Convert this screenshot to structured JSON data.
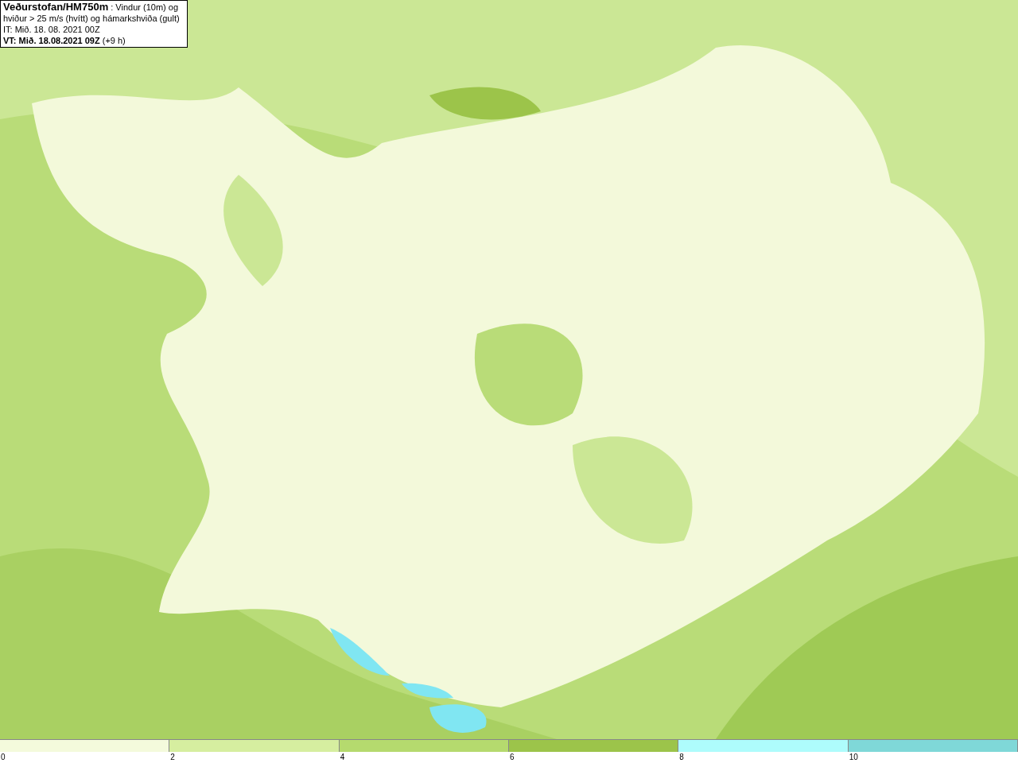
{
  "header": {
    "title_line": "**Veðurstofan/HM750m** : Vindur (10m) og hviður > 25 m/s (hvítt) og hámarkshviða (gult)",
    "initial_time": "IT: Mið. 18. 08. 2021 00Z",
    "valid_time": "**VT: Mið. 18.08.2021 09Z** (+9 h)"
  },
  "legend": {
    "bins": [
      {
        "color": "#f4fadc",
        "label": "0"
      },
      {
        "color": "#d6eea0",
        "label": "2"
      },
      {
        "color": "#b5da6e",
        "label": "4"
      },
      {
        "color": "#9cc44a",
        "label": "6"
      },
      {
        "color": "#aefcfc",
        "label": "8"
      },
      {
        "color": "#7fd8d8",
        "label": "10"
      }
    ]
  }
}
